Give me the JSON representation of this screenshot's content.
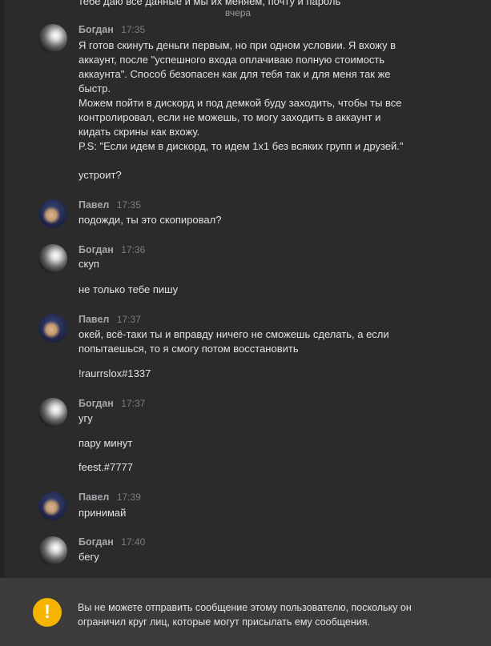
{
  "top_partial_text": "тебе даю все данные и мы их меняем, почту и пароль",
  "date_divider": "вчера",
  "messages": [
    {
      "author": "Богдан",
      "time": "17:35",
      "avatar": "bogdan-avatar",
      "lines": [
        "Я готов скинуть деньги первым, но при одном условии. Я вхожу в",
        "аккаунт, после \"успешного входа оплачиваю полную стоимость",
        "аккаунта\". Способ безопасен как для тебя так и для меня так же",
        "быстр.",
        "Можем пойти в дискорд и под демкой буду заходить, чтобы ты все",
        "контролировал, если не можешь, то могу заходить в аккаунт и",
        "кидать скрины как вхожу.",
        "P.S: \"Если идем в дискорд, то идем 1х1 без всяких групп и друзей.\"",
        "устроит?"
      ]
    },
    {
      "author": "Павел",
      "time": "17:35",
      "avatar": "pavel-avatar",
      "lines": [
        "подожди, ты это скопировал?"
      ]
    },
    {
      "author": "Богдан",
      "time": "17:36",
      "avatar": "bogdan-avatar",
      "lines": [
        "скуп",
        "не только тебе пишу"
      ]
    },
    {
      "author": "Павел",
      "time": "17:37",
      "avatar": "pavel-avatar",
      "lines": [
        "окей, всё-таки ты и вправду ничего не сможешь сделать, а если",
        "попытаешься, то я смогу потом восстановить",
        "!raurrslox#1337"
      ]
    },
    {
      "author": "Богдан",
      "time": "17:37",
      "avatar": "bogdan-avatar",
      "lines": [
        "угу",
        "пару минут",
        "feest.#7777"
      ]
    },
    {
      "author": "Павел",
      "time": "17:39",
      "avatar": "pavel-avatar",
      "lines": [
        "принимай"
      ]
    },
    {
      "author": "Богдан",
      "time": "17:40",
      "avatar": "bogdan-avatar",
      "lines": [
        "бегу"
      ]
    }
  ],
  "footer": {
    "icon": "exclamation-icon",
    "text": "Вы не можете отправить сообщение этому пользователю, поскольку он ограничил круг лиц, которые могут присылать ему сообщения."
  },
  "colors": {
    "background": "#2b2b2b",
    "footer_background": "#3b3b3b",
    "warning_accent": "#f5b400",
    "name_color": "#a5a8ad",
    "text_color": "#e1e3e6"
  }
}
